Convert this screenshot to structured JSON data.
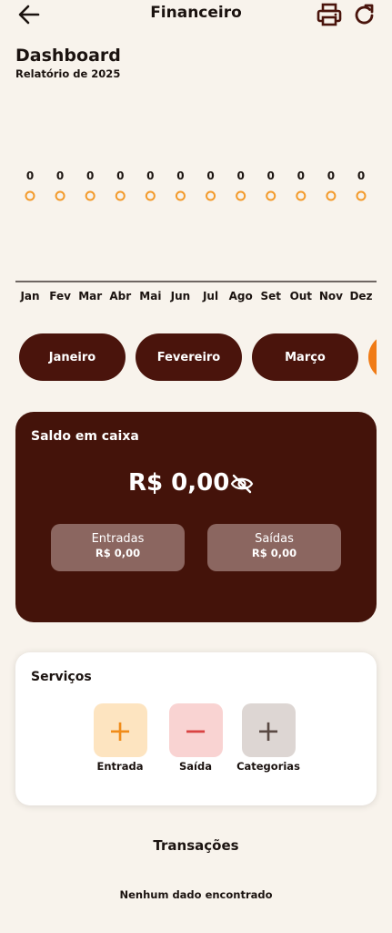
{
  "appbar": {
    "title": "Financeiro",
    "back_icon": "arrow-left-icon",
    "print_icon": "printer-icon",
    "refresh_icon": "refresh-icon"
  },
  "dashboard": {
    "title": "Dashboard",
    "subtitle": "Relatório de 2025"
  },
  "chart_data": {
    "type": "line",
    "categories": [
      "Jan",
      "Fev",
      "Mar",
      "Abr",
      "Mai",
      "Jun",
      "Jul",
      "Ago",
      "Set",
      "Out",
      "Nov",
      "Dez"
    ],
    "series": [
      {
        "values": [
          0,
          0,
          0,
          0,
          0,
          0,
          0,
          0,
          0,
          0,
          0,
          0
        ]
      }
    ],
    "data_labels": true,
    "point_color": "#f39a2b",
    "grid": false
  },
  "months": {
    "items": [
      "Janeiro",
      "Fevereiro",
      "Março",
      ""
    ],
    "pill_color": "#4a140c",
    "active_color": "#f07b16"
  },
  "saldo": {
    "label": "Saldo em caixa",
    "amount": "R$ 0,00",
    "toggle_icon": "eye-off-icon",
    "entradas_label": "Entradas",
    "entradas_value": "R$ 0,00",
    "saidas_label": "Saídas",
    "saidas_value": "R$ 0,00",
    "background": "#44130a"
  },
  "services": {
    "label": "Serviços",
    "items": [
      {
        "name": "Entrada",
        "icon": "plus-icon",
        "symbol": "+"
      },
      {
        "name": "Saída",
        "icon": "minus-icon",
        "symbol": "−"
      },
      {
        "name": "Categorias",
        "icon": "plus-icon",
        "symbol": "+"
      }
    ]
  },
  "transactions": {
    "title": "Transações",
    "empty_message": "Nenhum dado encontrado"
  }
}
